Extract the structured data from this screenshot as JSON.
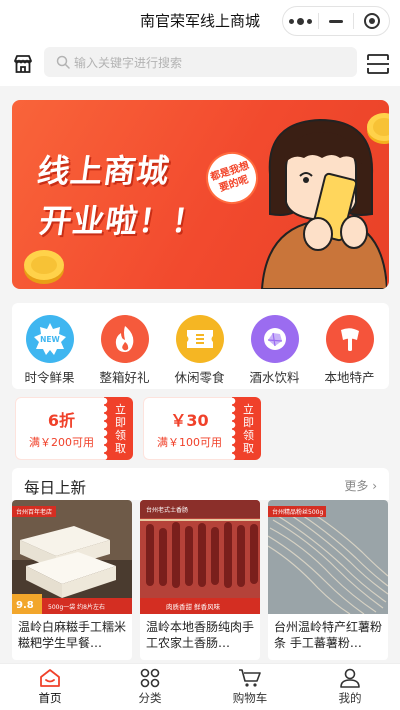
{
  "app": {
    "title": "南官荣军线上商城"
  },
  "search": {
    "placeholder": "输入关键字进行搜索"
  },
  "banner": {
    "line1": "线上商城",
    "line2": "开业啦！！",
    "bubble": "都是我想要的呢"
  },
  "categories": [
    {
      "label": "时令鲜果",
      "icon": "new-badge-icon",
      "color": "#3fb6f0"
    },
    {
      "label": "整箱好礼",
      "icon": "flame-icon",
      "color": "#f55a3c"
    },
    {
      "label": "休闲零食",
      "icon": "ticket-icon",
      "color": "#f5b623"
    },
    {
      "label": "酒水饮料",
      "icon": "gem-icon",
      "color": "#9b6cf0"
    },
    {
      "label": "本地特产",
      "icon": "axe-icon",
      "color": "#f5543b"
    }
  ],
  "coupons": [
    {
      "amount": "6折",
      "condition": "满￥200可用",
      "action": "立即领取"
    },
    {
      "amount": "￥30",
      "condition": "满￥100可用",
      "action": "立即领取"
    }
  ],
  "daily": {
    "title": "每日上新",
    "more": "更多"
  },
  "products": [
    {
      "name": "温岭白麻糍手工糯米糍粑学生早餐…",
      "tag": "台州百年老店",
      "price": "9.8",
      "promo": "500g一袋 约8片左右"
    },
    {
      "name": "温岭本地香肠纯肉手工农家土香肠…",
      "tag": "台州老式土香肠",
      "promo": "肉质香甜 鲜香风味"
    },
    {
      "name": "台州温岭特产红薯粉条 手工蕃薯粉…",
      "tag": "台州精品粉丝500g"
    }
  ],
  "tabs": [
    {
      "label": "首页",
      "icon": "home-icon",
      "active": true
    },
    {
      "label": "分类",
      "icon": "category-icon"
    },
    {
      "label": "购物车",
      "icon": "cart-icon"
    },
    {
      "label": "我的",
      "icon": "profile-icon"
    }
  ],
  "colors": {
    "accent": "#f0412a",
    "banner": "#f24a2e"
  }
}
